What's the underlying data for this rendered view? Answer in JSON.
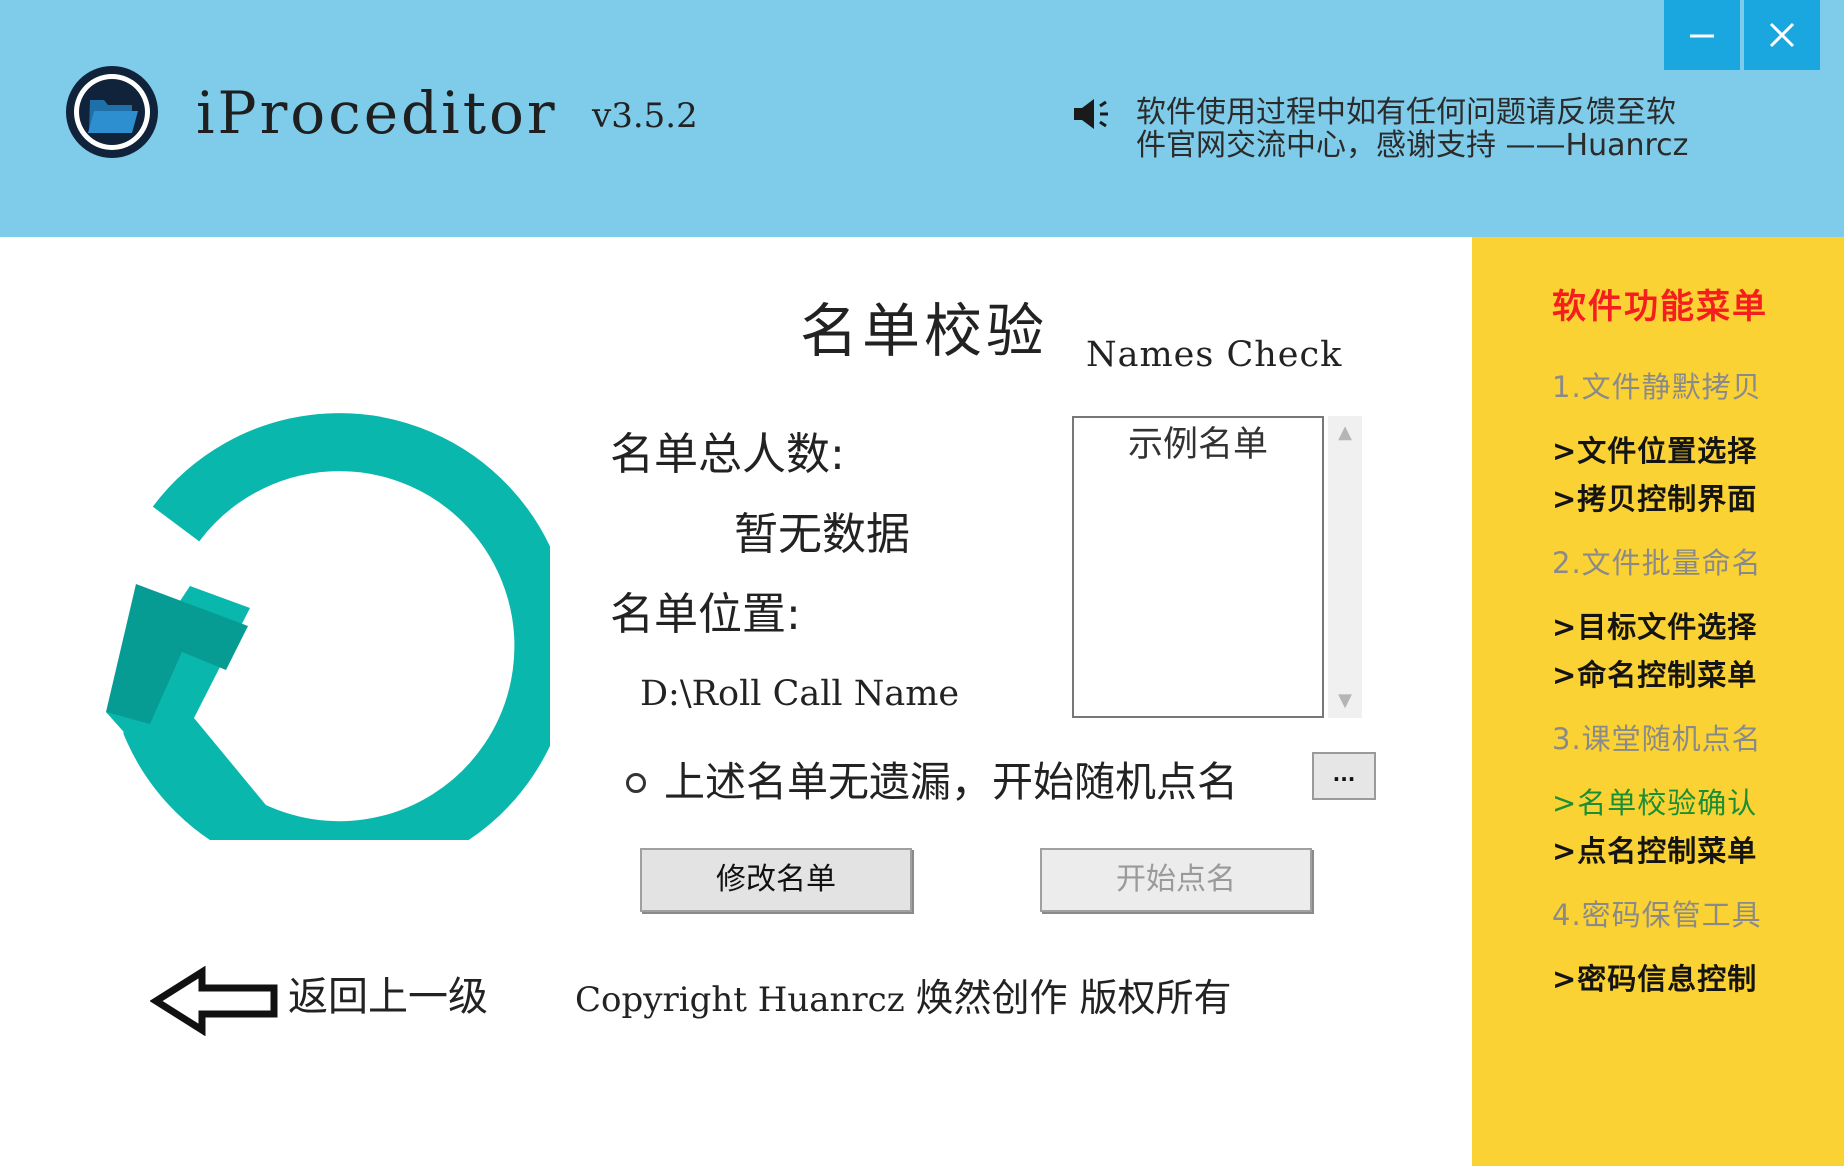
{
  "header": {
    "app_name": "iProceditor",
    "version": "v3.5.2",
    "notice_line1": "软件使用过程中如有任何问题请反馈至软",
    "notice_line2": "件官网交流中心，感谢支持  ——Huanrcz",
    "background_color": "#7ecbea",
    "window_button_color": "#1aa7e0",
    "icons": [
      "folder-app-icon",
      "speaker-icon",
      "minimize-icon",
      "close-icon"
    ]
  },
  "main": {
    "title": "名单校验",
    "title_en": "Names Check",
    "total_label": "名单总人数:",
    "total_value": "暂无数据",
    "location_label": "名单位置:",
    "location_value": "D:\\Roll Call Name",
    "list_items": [
      "示例名单"
    ],
    "radio_label": "上述名单无遗漏，开始随机点名",
    "dots_label": "...",
    "modify_button": "修改名单",
    "start_button": "开始点名",
    "back_label": "返回上一级",
    "copyright_en": "Copyright Huanrcz",
    "copyright_zh": "焕然创作 版权所有",
    "logo_colors": [
      "#0ab7ad",
      "#079c93"
    ]
  },
  "side_menu": {
    "title": "软件功能菜单",
    "background_color": "#fbd233",
    "title_color": "#f51d1d",
    "active_color": "#1c8f36",
    "items": [
      {
        "label": "1.文件静默拷贝",
        "kind": "section"
      },
      {
        "label": ">文件位置选择",
        "kind": "sub"
      },
      {
        "label": ">拷贝控制界面",
        "kind": "sub"
      },
      {
        "label": "2.文件批量命名",
        "kind": "section"
      },
      {
        "label": ">目标文件选择",
        "kind": "sub"
      },
      {
        "label": ">命名控制菜单",
        "kind": "sub"
      },
      {
        "label": "3.课堂随机点名",
        "kind": "section"
      },
      {
        "label": ">名单校验确认",
        "kind": "active"
      },
      {
        "label": ">点名控制菜单",
        "kind": "sub"
      },
      {
        "label": "4.密码保管工具",
        "kind": "section"
      },
      {
        "label": ">密码信息控制",
        "kind": "sub"
      }
    ]
  }
}
